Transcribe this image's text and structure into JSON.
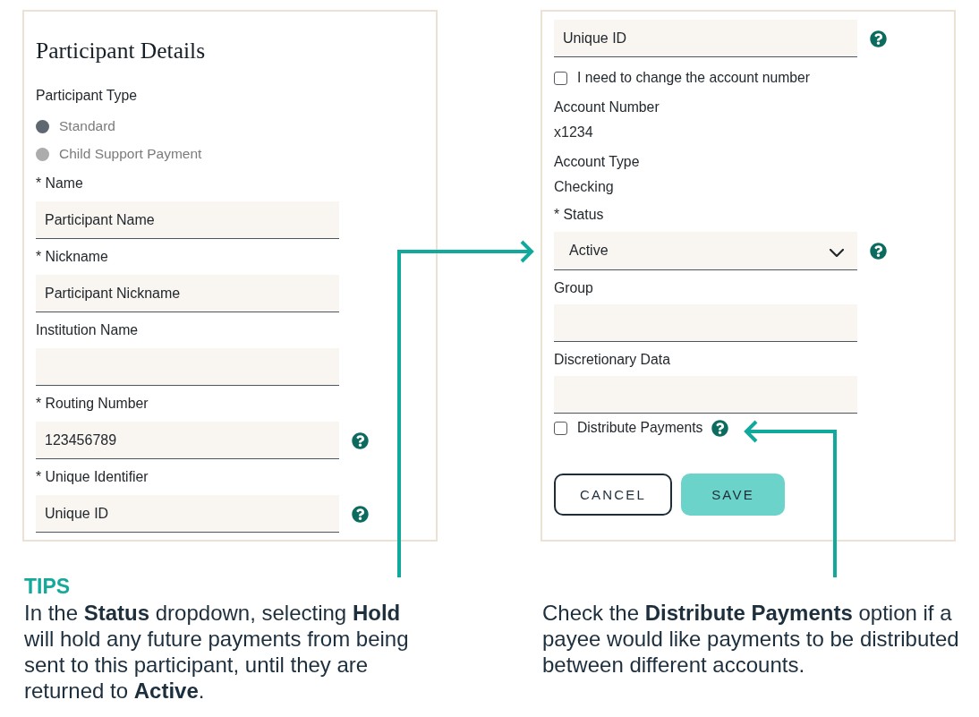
{
  "participant_details": {
    "title": "Participant Details",
    "participant_type": {
      "label": "Participant Type",
      "options": [
        {
          "label": "Standard",
          "selected": true
        },
        {
          "label": "Child Support Payment",
          "selected": false
        }
      ]
    },
    "fields": [
      {
        "label": "* Name",
        "value": "Participant Name"
      },
      {
        "label": "* Nickname",
        "value": "Participant Nickname"
      },
      {
        "label": "Institution Name"
      },
      {
        "label": "* Routing Number",
        "value": "123456789",
        "help": true
      },
      {
        "label": "* Unique Identifier",
        "value": "Unique ID",
        "help": true
      }
    ]
  },
  "account_panel": {
    "items": [
      {
        "kind": "input",
        "value": "Unique ID",
        "help": true
      },
      {
        "kind": "checkbox",
        "label": "I need to change the account number",
        "checked": false
      },
      {
        "kind": "static",
        "label": "Account Number",
        "value": "x1234"
      },
      {
        "kind": "static",
        "label": "Account Type",
        "value": "Checking"
      },
      {
        "kind": "select",
        "label": "* Status",
        "value": "Active",
        "help": true
      },
      {
        "kind": "input",
        "label": "Group"
      },
      {
        "kind": "input",
        "label": "Discretionary Data"
      },
      {
        "kind": "checkbox",
        "label": "Distribute Payments",
        "checked": false,
        "help": true
      }
    ],
    "buttons": [
      {
        "label": "CANCEL",
        "kind": "secondary"
      },
      {
        "label": "SAVE",
        "kind": "primary"
      }
    ]
  },
  "tips": {
    "heading": "TIPS",
    "text": "In the **Status** dropdown, selecting **Hold** will hold any future payments from being sent to this participant, until they are returned to **Active**."
  },
  "note": {
    "text": "Check the **Distribute Payments** option if a payee would like payments to be distributed between different accounts."
  }
}
